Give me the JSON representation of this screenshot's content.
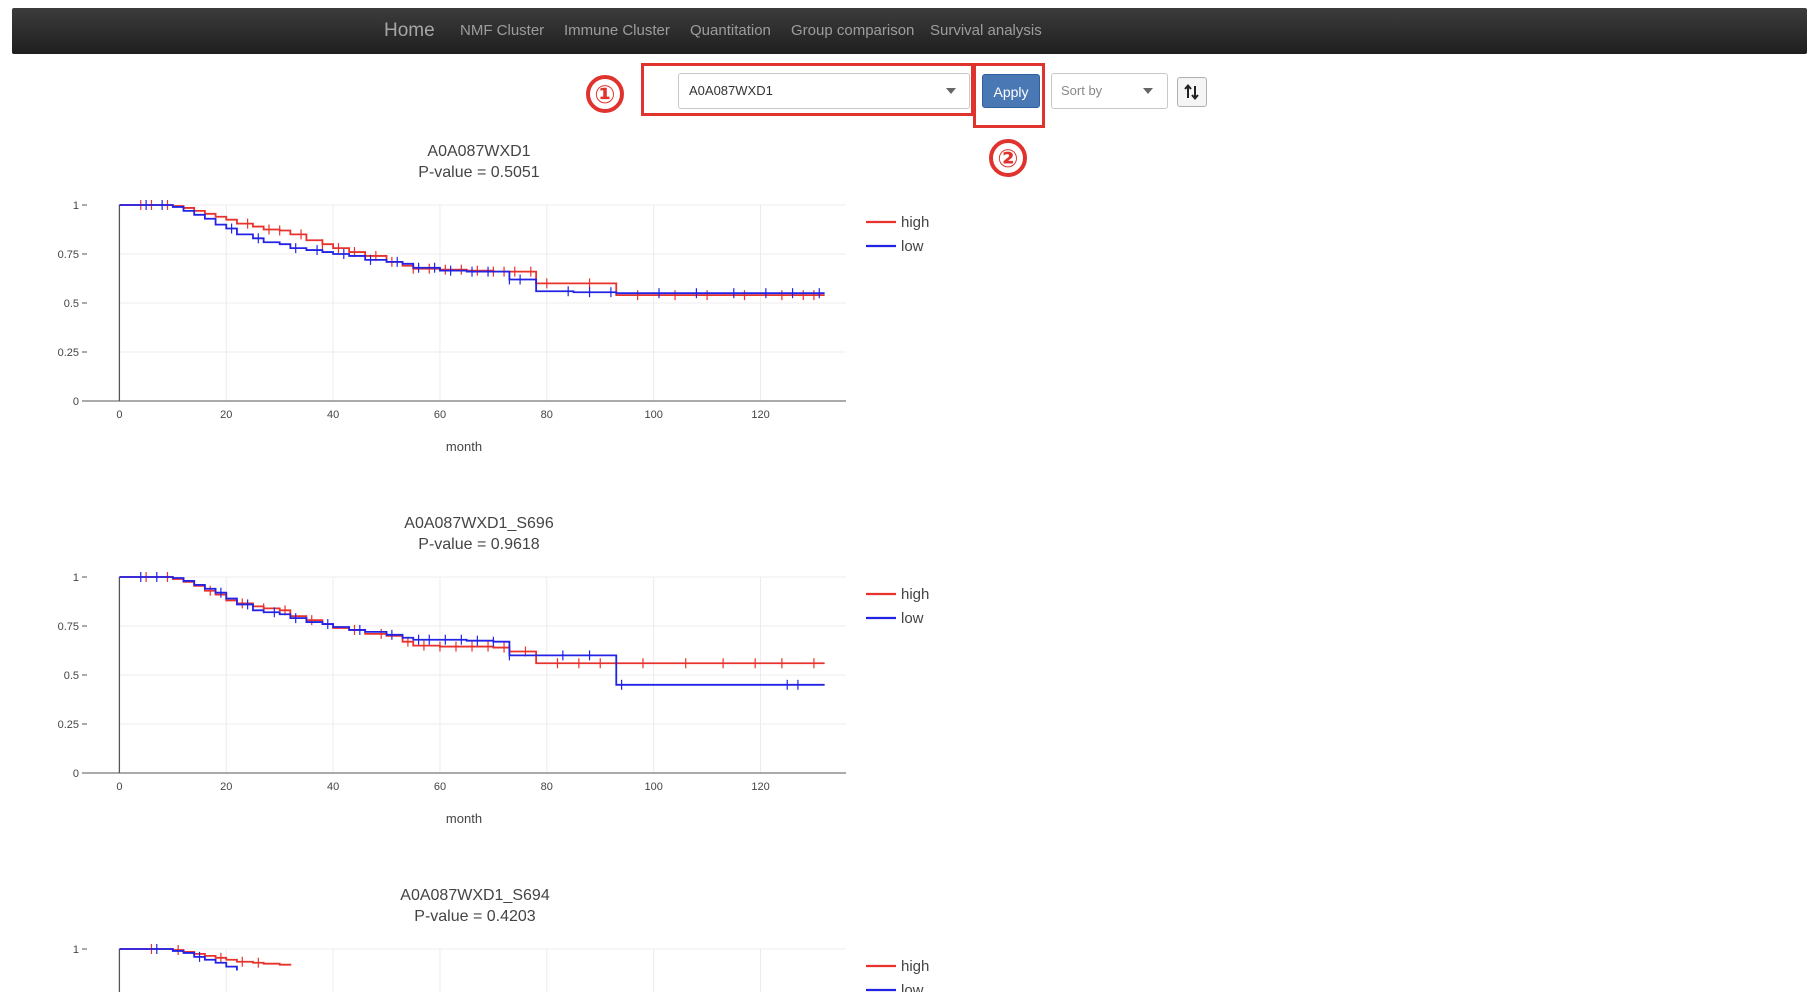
{
  "nav": {
    "home": "Home",
    "items": [
      "NMF Cluster",
      "Immune Cluster",
      "Quantitation",
      "Group comparison",
      "Survival analysis"
    ]
  },
  "controls": {
    "selected_gene": "A0A087WXD1",
    "apply_label": "Apply",
    "sort_placeholder": "Sort by"
  },
  "annotations": [
    "①",
    "②"
  ],
  "colors": {
    "high": "#e8322c",
    "low": "#2323e6",
    "accent": "#e0332e",
    "apply": "#4a78b5"
  },
  "chart_data": [
    {
      "type": "line",
      "title": "A0A087WXD1",
      "subtitle": "P-value = 0.5051",
      "xlabel": "month",
      "ylabel": "",
      "xlim": [
        -7,
        136
      ],
      "ylim": [
        0,
        1
      ],
      "xticks": [
        0,
        20,
        40,
        60,
        80,
        100,
        120
      ],
      "yticks": [
        0,
        0.25,
        0.5,
        0.75,
        1
      ],
      "legend": "top-right",
      "series": [
        {
          "name": "high",
          "color": "#e8322c",
          "x": [
            0,
            3,
            10,
            12,
            14,
            16,
            18,
            20,
            22,
            25,
            27,
            30,
            32,
            35,
            38,
            40,
            43,
            46,
            50,
            53,
            55,
            60,
            65,
            70,
            73,
            78,
            85,
            93,
            100,
            110,
            120,
            132
          ],
          "y": [
            1,
            1,
            0.995,
            0.985,
            0.97,
            0.955,
            0.94,
            0.925,
            0.905,
            0.89,
            0.875,
            0.87,
            0.85,
            0.82,
            0.8,
            0.78,
            0.76,
            0.74,
            0.71,
            0.69,
            0.675,
            0.67,
            0.665,
            0.66,
            0.66,
            0.6,
            0.6,
            0.54,
            0.54,
            0.54,
            0.54,
            0.54
          ],
          "censor_x": [
            4,
            6,
            9,
            24,
            28,
            30,
            34,
            38,
            41,
            44,
            48,
            51,
            55,
            58,
            61,
            64,
            67,
            70,
            72,
            74,
            77,
            80,
            88,
            97,
            104,
            110,
            117,
            124,
            128,
            130
          ]
        },
        {
          "name": "low",
          "color": "#2323e6",
          "x": [
            0,
            3,
            10,
            12,
            14,
            16,
            18,
            20,
            22,
            25,
            27,
            30,
            32,
            35,
            38,
            40,
            43,
            46,
            50,
            53,
            55,
            60,
            65,
            70,
            73,
            78,
            85,
            93,
            100,
            110,
            120,
            132
          ],
          "y": [
            1,
            1,
            0.99,
            0.97,
            0.95,
            0.93,
            0.9,
            0.88,
            0.85,
            0.83,
            0.81,
            0.8,
            0.78,
            0.77,
            0.76,
            0.75,
            0.74,
            0.72,
            0.71,
            0.7,
            0.68,
            0.665,
            0.66,
            0.66,
            0.62,
            0.56,
            0.555,
            0.55,
            0.55,
            0.55,
            0.55,
            0.55
          ],
          "censor_x": [
            5,
            8,
            21,
            26,
            33,
            37,
            42,
            47,
            52,
            56,
            59,
            62,
            66,
            69,
            73,
            75,
            84,
            88,
            92,
            101,
            108,
            115,
            121,
            126,
            131
          ]
        }
      ]
    },
    {
      "type": "line",
      "title": "A0A087WXD1_S696",
      "subtitle": "P-value = 0.9618",
      "xlabel": "month",
      "ylabel": "",
      "xlim": [
        -7,
        136
      ],
      "ylim": [
        0,
        1
      ],
      "xticks": [
        0,
        20,
        40,
        60,
        80,
        100,
        120
      ],
      "yticks": [
        0,
        0.25,
        0.5,
        0.75,
        1
      ],
      "legend": "top-right",
      "series": [
        {
          "name": "high",
          "color": "#e8322c",
          "x": [
            0,
            3,
            10,
            12,
            14,
            16,
            18,
            20,
            22,
            25,
            27,
            30,
            32,
            35,
            38,
            40,
            43,
            46,
            50,
            53,
            55,
            60,
            65,
            70,
            73,
            78,
            85,
            93,
            100,
            110,
            120,
            132
          ],
          "y": [
            1,
            1,
            0.99,
            0.975,
            0.955,
            0.93,
            0.91,
            0.88,
            0.865,
            0.85,
            0.84,
            0.83,
            0.8,
            0.78,
            0.76,
            0.74,
            0.73,
            0.71,
            0.7,
            0.67,
            0.65,
            0.645,
            0.645,
            0.64,
            0.62,
            0.56,
            0.56,
            0.56,
            0.56,
            0.56,
            0.56,
            0.56
          ],
          "censor_x": [
            5,
            9,
            17,
            23,
            27,
            31,
            36,
            44,
            49,
            54,
            57,
            60,
            63,
            66,
            69,
            72,
            76,
            82,
            86,
            90,
            98,
            106,
            113,
            119,
            124,
            130
          ]
        },
        {
          "name": "low",
          "color": "#2323e6",
          "x": [
            0,
            3,
            10,
            12,
            14,
            16,
            18,
            20,
            22,
            25,
            27,
            30,
            32,
            35,
            38,
            40,
            43,
            46,
            50,
            53,
            55,
            60,
            65,
            70,
            73,
            78,
            85,
            93,
            100,
            110,
            120,
            132
          ],
          "y": [
            1,
            1,
            0.995,
            0.98,
            0.96,
            0.94,
            0.92,
            0.89,
            0.86,
            0.83,
            0.82,
            0.81,
            0.79,
            0.77,
            0.76,
            0.745,
            0.73,
            0.72,
            0.705,
            0.69,
            0.68,
            0.68,
            0.675,
            0.67,
            0.6,
            0.6,
            0.6,
            0.45,
            0.45,
            0.45,
            0.45,
            0.45
          ],
          "censor_x": [
            4,
            7,
            19,
            24,
            29,
            33,
            39,
            45,
            51,
            56,
            58,
            61,
            64,
            67,
            70,
            73,
            83,
            88,
            94,
            125,
            127
          ]
        }
      ]
    },
    {
      "type": "line",
      "title": "A0A087WXD1_S694",
      "subtitle": "P-value = 0.4203",
      "xlabel": "",
      "ylabel": "",
      "xlim": [
        -7,
        136
      ],
      "ylim": [
        0,
        1
      ],
      "xticks": [],
      "yticks": [
        1
      ],
      "legend": "top-right",
      "series": [
        {
          "name": "high",
          "color": "#e8322c",
          "x": [
            0,
            3,
            10,
            12,
            14,
            16,
            18,
            20,
            22,
            25,
            27,
            30,
            32
          ],
          "y": [
            1,
            1,
            0.995,
            0.985,
            0.975,
            0.965,
            0.955,
            0.945,
            0.935,
            0.93,
            0.925,
            0.92,
            0.915
          ],
          "censor_x": [
            6,
            11,
            19,
            23,
            26
          ]
        },
        {
          "name": "low",
          "color": "#2323e6",
          "x": [
            0,
            3,
            10,
            12,
            14,
            16,
            18,
            20,
            22
          ],
          "y": [
            1,
            1,
            0.99,
            0.98,
            0.96,
            0.945,
            0.93,
            0.91,
            0.89
          ],
          "censor_x": [
            7,
            15
          ]
        }
      ]
    }
  ]
}
